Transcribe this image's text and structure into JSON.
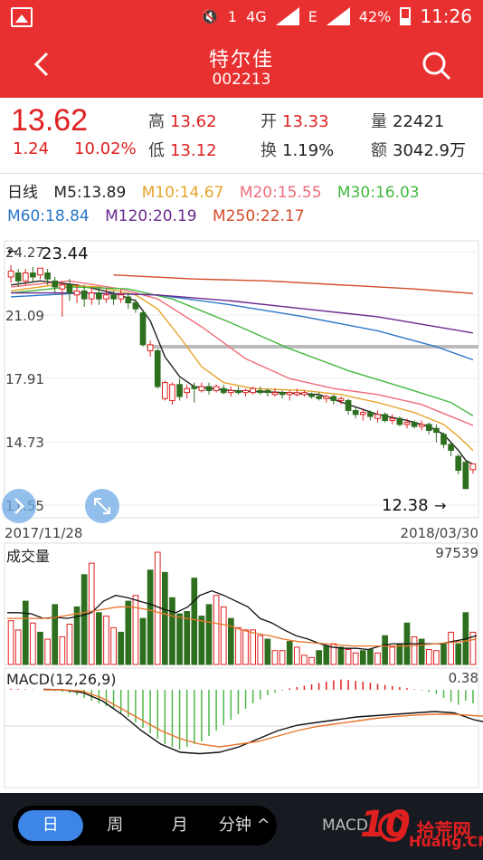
{
  "status_bar": {
    "signal_type_1": "4G",
    "signal_type_2": "E",
    "sim_badge": "1",
    "battery_percent": "42%",
    "time": "11:26"
  },
  "header": {
    "stock_name": "特尔佳",
    "stock_code": "002213",
    "back_icon": "chevron-left-icon",
    "search_icon": "search-icon"
  },
  "quote": {
    "price": "13.62",
    "change": "1.24",
    "change_pct": "10.02%",
    "high_label": "高",
    "high": "13.62",
    "open_label": "开",
    "open": "13.33",
    "volume_label": "量",
    "volume": "22421",
    "low_label": "低",
    "low": "13.12",
    "turnover_label": "换",
    "turnover": "1.19%",
    "amount_label": "额",
    "amount": "3042.9万"
  },
  "ma_legend": {
    "period": "日线",
    "items": [
      {
        "label": "M5:13.89",
        "color": "#222222"
      },
      {
        "label": "M10:14.67",
        "color": "#e6a32a"
      },
      {
        "label": "M20:15.55",
        "color": "#ef6d7a"
      },
      {
        "label": "M30:16.03",
        "color": "#43b83f"
      },
      {
        "label": "M60:18.84",
        "color": "#2a77c7"
      },
      {
        "label": "M120:20.19",
        "color": "#6a2a8f"
      },
      {
        "label": "M250:22.17",
        "color": "#d44a2a"
      }
    ]
  },
  "price_chart": {
    "y_labels": [
      "24.27",
      "21.09",
      "17.91",
      "14.73",
      "11.55"
    ],
    "max_marker": "23.44",
    "min_marker": "12.38",
    "start_date": "2017/11/28",
    "end_date": "2018/03/30"
  },
  "volume_chart": {
    "title": "成交量",
    "max_value": "97539"
  },
  "macd_chart": {
    "title": "MACD(12,26,9)",
    "value": "0.38"
  },
  "bottom_bar": {
    "periods": [
      {
        "label": "日",
        "active": true
      },
      {
        "label": "周",
        "active": false
      },
      {
        "label": "月",
        "active": false
      },
      {
        "label": "分钟 ^",
        "active": false
      }
    ],
    "indicator": "MACD",
    "watermark_digits": "10",
    "watermark_text": "拾荒网",
    "watermark_url": "Huang.CN"
  },
  "colors": {
    "up": "#e02020",
    "down": "#2e6e1f",
    "brand": "#e93030"
  },
  "chart_data": [
    {
      "type": "candlestick",
      "title": "",
      "x_range": [
        "2017/11/28",
        "2018/03/30"
      ],
      "ylim": [
        11.55,
        24.27
      ],
      "candles": [
        {
          "o": 23.0,
          "c": 23.3,
          "h": 23.6,
          "l": 22.7
        },
        {
          "o": 23.2,
          "c": 22.8,
          "h": 23.4,
          "l": 22.5
        },
        {
          "o": 22.8,
          "c": 23.2,
          "h": 23.4,
          "l": 22.6
        },
        {
          "o": 23.2,
          "c": 23.0,
          "h": 23.5,
          "l": 22.7
        },
        {
          "o": 23.1,
          "c": 23.44,
          "h": 23.44,
          "l": 22.9
        },
        {
          "o": 23.2,
          "c": 22.9,
          "h": 23.4,
          "l": 22.6
        },
        {
          "o": 22.8,
          "c": 22.5,
          "h": 23.0,
          "l": 22.2
        },
        {
          "o": 22.4,
          "c": 22.6,
          "h": 22.8,
          "l": 21.0
        },
        {
          "o": 22.6,
          "c": 22.2,
          "h": 22.9,
          "l": 21.8
        },
        {
          "o": 22.1,
          "c": 22.3,
          "h": 22.6,
          "l": 21.7
        },
        {
          "o": 22.3,
          "c": 21.9,
          "h": 22.6,
          "l": 21.5
        },
        {
          "o": 21.9,
          "c": 22.2,
          "h": 22.5,
          "l": 21.6
        },
        {
          "o": 22.2,
          "c": 21.9,
          "h": 22.5,
          "l": 21.6
        },
        {
          "o": 21.9,
          "c": 22.1,
          "h": 22.4,
          "l": 21.7
        },
        {
          "o": 22.1,
          "c": 21.9,
          "h": 22.3,
          "l": 21.6
        },
        {
          "o": 21.9,
          "c": 22.1,
          "h": 22.4,
          "l": 21.7
        },
        {
          "o": 22.0,
          "c": 21.7,
          "h": 22.2,
          "l": 21.4
        },
        {
          "o": 21.7,
          "c": 21.4,
          "h": 21.9,
          "l": 21.2
        },
        {
          "o": 21.2,
          "c": 19.6,
          "h": 21.3,
          "l": 19.5
        },
        {
          "o": 19.3,
          "c": 19.6,
          "h": 19.8,
          "l": 19.0
        },
        {
          "o": 19.3,
          "c": 17.5,
          "h": 19.4,
          "l": 17.4
        },
        {
          "o": 16.9,
          "c": 17.7,
          "h": 17.8,
          "l": 16.8
        },
        {
          "o": 16.8,
          "c": 17.6,
          "h": 17.7,
          "l": 16.6
        },
        {
          "o": 17.6,
          "c": 17.0,
          "h": 17.9,
          "l": 16.8
        },
        {
          "o": 17.2,
          "c": 17.4,
          "h": 17.6,
          "l": 16.9
        },
        {
          "o": 17.5,
          "c": 17.4,
          "h": 17.7,
          "l": 16.7
        },
        {
          "o": 17.3,
          "c": 17.5,
          "h": 17.7,
          "l": 17.2
        },
        {
          "o": 17.5,
          "c": 17.3,
          "h": 17.7,
          "l": 17.1
        },
        {
          "o": 17.3,
          "c": 17.5,
          "h": 17.6,
          "l": 17.2
        },
        {
          "o": 17.4,
          "c": 17.2,
          "h": 17.6,
          "l": 17.1
        },
        {
          "o": 17.2,
          "c": 17.3,
          "h": 17.5,
          "l": 17.0
        },
        {
          "o": 17.3,
          "c": 17.2,
          "h": 17.5,
          "l": 17.1
        },
        {
          "o": 17.2,
          "c": 17.3,
          "h": 17.4,
          "l": 17.0
        },
        {
          "o": 17.2,
          "c": 17.4,
          "h": 17.5,
          "l": 17.1
        },
        {
          "o": 17.3,
          "c": 17.2,
          "h": 17.5,
          "l": 17.1
        },
        {
          "o": 17.3,
          "c": 17.2,
          "h": 17.4,
          "l": 17.0
        },
        {
          "o": 17.1,
          "c": 17.2,
          "h": 17.4,
          "l": 17.0
        },
        {
          "o": 17.2,
          "c": 17.1,
          "h": 17.3,
          "l": 16.9
        },
        {
          "o": 17.1,
          "c": 17.2,
          "h": 17.3,
          "l": 16.8
        },
        {
          "o": 17.1,
          "c": 17.2,
          "h": 17.4,
          "l": 17.0
        },
        {
          "o": 17.1,
          "c": 17.2,
          "h": 17.3,
          "l": 17.0
        },
        {
          "o": 17.1,
          "c": 17.0,
          "h": 17.2,
          "l": 16.9
        },
        {
          "o": 17.0,
          "c": 16.9,
          "h": 17.2,
          "l": 16.8
        },
        {
          "o": 16.9,
          "c": 17.0,
          "h": 17.1,
          "l": 16.7
        },
        {
          "o": 17.0,
          "c": 16.8,
          "h": 17.1,
          "l": 16.6
        },
        {
          "o": 16.8,
          "c": 16.9,
          "h": 17.0,
          "l": 16.6
        },
        {
          "o": 16.8,
          "c": 16.3,
          "h": 16.9,
          "l": 16.1
        },
        {
          "o": 16.3,
          "c": 16.1,
          "h": 16.5,
          "l": 15.9
        },
        {
          "o": 16.1,
          "c": 16.2,
          "h": 16.4,
          "l": 15.8
        },
        {
          "o": 16.2,
          "c": 16.0,
          "h": 16.3,
          "l": 15.8
        },
        {
          "o": 15.9,
          "c": 16.1,
          "h": 16.3,
          "l": 15.7
        },
        {
          "o": 16.1,
          "c": 15.8,
          "h": 16.2,
          "l": 15.7
        },
        {
          "o": 15.8,
          "c": 15.9,
          "h": 16.1,
          "l": 15.6
        },
        {
          "o": 15.9,
          "c": 15.6,
          "h": 16.0,
          "l": 15.5
        },
        {
          "o": 15.6,
          "c": 15.7,
          "h": 15.9,
          "l": 15.4
        },
        {
          "o": 15.7,
          "c": 15.5,
          "h": 15.8,
          "l": 15.4
        },
        {
          "o": 15.5,
          "c": 15.6,
          "h": 15.8,
          "l": 15.3
        },
        {
          "o": 15.6,
          "c": 15.3,
          "h": 15.7,
          "l": 15.1
        },
        {
          "o": 15.4,
          "c": 15.2,
          "h": 15.6,
          "l": 14.7
        },
        {
          "o": 15.1,
          "c": 14.6,
          "h": 15.2,
          "l": 14.4
        },
        {
          "o": 14.6,
          "c": 14.3,
          "h": 14.7,
          "l": 14.0
        },
        {
          "o": 14.0,
          "c": 13.3,
          "h": 14.1,
          "l": 13.1
        },
        {
          "o": 13.7,
          "c": 12.38,
          "h": 13.8,
          "l": 12.38
        },
        {
          "o": 13.33,
          "c": 13.62,
          "h": 13.62,
          "l": 13.12
        }
      ],
      "ma_series": [
        {
          "name": "M5",
          "color": "#222222",
          "values": [
            [
              0,
              22.6
            ],
            [
              4,
              22.8
            ],
            [
              9,
              22.6
            ],
            [
              14,
              22.2
            ],
            [
              17,
              21.8
            ],
            [
              19,
              20.8
            ],
            [
              21,
              19.0
            ],
            [
              23,
              18.0
            ],
            [
              25,
              17.5
            ],
            [
              30,
              17.3
            ],
            [
              37,
              17.2
            ],
            [
              42,
              17.1
            ],
            [
              46,
              16.6
            ],
            [
              50,
              16.1
            ],
            [
              54,
              15.8
            ],
            [
              57,
              15.5
            ],
            [
              59,
              15.1
            ],
            [
              61,
              14.3
            ],
            [
              62,
              13.8
            ],
            [
              63,
              13.6
            ]
          ]
        },
        {
          "name": "M10",
          "color": "#e6a32a",
          "values": [
            [
              0,
              22.3
            ],
            [
              6,
              22.6
            ],
            [
              12,
              22.5
            ],
            [
              17,
              22.1
            ],
            [
              20,
              21.4
            ],
            [
              23,
              20.0
            ],
            [
              26,
              18.5
            ],
            [
              29,
              17.7
            ],
            [
              33,
              17.4
            ],
            [
              40,
              17.3
            ],
            [
              45,
              17.1
            ],
            [
              50,
              16.7
            ],
            [
              55,
              16.2
            ],
            [
              59,
              15.6
            ],
            [
              61,
              15.0
            ],
            [
              63,
              14.3
            ]
          ]
        },
        {
          "name": "M20",
          "color": "#ef6d7a",
          "values": [
            [
              0,
              22.5
            ],
            [
              8,
              22.8
            ],
            [
              15,
              22.4
            ],
            [
              20,
              21.9
            ],
            [
              26,
              20.5
            ],
            [
              32,
              18.9
            ],
            [
              38,
              17.9
            ],
            [
              44,
              17.4
            ],
            [
              50,
              17.1
            ],
            [
              56,
              16.6
            ],
            [
              60,
              16.0
            ],
            [
              63,
              15.55
            ]
          ]
        },
        {
          "name": "M30",
          "color": "#43b83f",
          "values": [
            [
              0,
              22.2
            ],
            [
              8,
              22.5
            ],
            [
              16,
              22.4
            ],
            [
              22,
              21.9
            ],
            [
              30,
              20.7
            ],
            [
              38,
              19.4
            ],
            [
              46,
              18.3
            ],
            [
              54,
              17.4
            ],
            [
              60,
              16.7
            ],
            [
              63,
              16.03
            ]
          ]
        },
        {
          "name": "M60",
          "color": "#2a77c7",
          "values": [
            [
              0,
              22.0
            ],
            [
              10,
              22.2
            ],
            [
              20,
              22.1
            ],
            [
              30,
              21.6
            ],
            [
              40,
              21.0
            ],
            [
              50,
              20.3
            ],
            [
              58,
              19.5
            ],
            [
              63,
              18.84
            ]
          ]
        },
        {
          "name": "M120",
          "color": "#6a2a8f",
          "values": [
            [
              0,
              22.2
            ],
            [
              10,
              22.2
            ],
            [
              20,
              22.1
            ],
            [
              30,
              21.8
            ],
            [
              40,
              21.4
            ],
            [
              50,
              21.0
            ],
            [
              58,
              20.5
            ],
            [
              63,
              20.19
            ]
          ]
        },
        {
          "name": "M250",
          "color": "#d44a2a",
          "values": [
            [
              14,
              23.1
            ],
            [
              25,
              22.9
            ],
            [
              35,
              22.8
            ],
            [
              45,
              22.6
            ],
            [
              55,
              22.4
            ],
            [
              63,
              22.17
            ]
          ]
        }
      ],
      "reference_line": 19.5
    },
    {
      "type": "bar",
      "title": "成交量",
      "ylim": [
        0,
        97539
      ],
      "values": [
        38000,
        30000,
        55000,
        36000,
        28000,
        22000,
        52000,
        24000,
        35000,
        50000,
        78000,
        88000,
        45000,
        42000,
        32000,
        28000,
        55000,
        60000,
        40000,
        82000,
        97539,
        80000,
        58000,
        44000,
        46000,
        75000,
        42000,
        52000,
        60000,
        50000,
        40000,
        32000,
        30000,
        30000,
        25000,
        22000,
        12000,
        12000,
        20000,
        15000,
        8000,
        6000,
        12000,
        16000,
        18000,
        15000,
        13000,
        10000,
        12000,
        13000,
        10000,
        25000,
        15000,
        18000,
        36000,
        24000,
        22000,
        13000,
        12000,
        18000,
        28000,
        18000,
        45000,
        28000
      ],
      "up": [
        1,
        1,
        0,
        1,
        0,
        1,
        0,
        1,
        1,
        0,
        0,
        1,
        0,
        1,
        1,
        0,
        0,
        1,
        0,
        0,
        1,
        0,
        0,
        0,
        0,
        0,
        0,
        0,
        1,
        1,
        0,
        1,
        1,
        1,
        1,
        0,
        1,
        1,
        0,
        1,
        1,
        1,
        0,
        0,
        1,
        0,
        1,
        1,
        0,
        0,
        1,
        0,
        1,
        0,
        0,
        1,
        0,
        1,
        1,
        0,
        1,
        0,
        0,
        1
      ],
      "ma1": [
        45000,
        45000,
        44000,
        40000,
        41000,
        40000,
        42000,
        45000,
        55000,
        60000,
        58000,
        55000,
        52000,
        48000,
        45000,
        50000,
        60000,
        64000,
        60000,
        55000,
        50000,
        40000,
        36000,
        30000,
        25000,
        22000,
        18000,
        15000,
        14000,
        14000,
        13000,
        16000,
        18000,
        18000,
        18000,
        18000,
        18000,
        20000,
        22000,
        25000
      ],
      "ma2": [
        40000,
        40000,
        40000,
        40000,
        42000,
        44000,
        46000,
        48000,
        50000,
        50000,
        48000,
        45000,
        42000,
        40000,
        38000,
        36000,
        34000,
        30000,
        27000,
        25000,
        22000,
        20000,
        19000,
        18000,
        17000,
        16000,
        16000,
        16000,
        16000,
        16000,
        17000,
        18000,
        19000,
        20000,
        22000
      ]
    },
    {
      "type": "bar",
      "title": "MACD(12,26,9)",
      "values": [
        0.04,
        0.03,
        0.02,
        0.01,
        0.0,
        -0.02,
        -0.05,
        -0.08,
        -0.12,
        -0.2,
        -0.3,
        -0.4,
        -0.5,
        -0.6,
        -0.7,
        -0.85,
        -1.0,
        -1.2,
        -1.4,
        -1.6,
        -1.8,
        -2.0,
        -2.1,
        -2.2,
        -2.1,
        -2.0,
        -1.9,
        -1.7,
        -1.5,
        -1.3,
        -1.1,
        -0.9,
        -0.7,
        -0.5,
        -0.35,
        -0.2,
        -0.1,
        -0.03,
        0.05,
        0.1,
        0.15,
        0.2,
        0.25,
        0.3,
        0.35,
        0.38,
        0.36,
        0.33,
        0.3,
        0.26,
        0.22,
        0.18,
        0.14,
        0.1,
        0.06,
        0.02,
        -0.02,
        -0.08,
        -0.15,
        -0.3,
        -0.45,
        -0.55,
        -0.4,
        -0.5
      ],
      "dif": [
        0.02,
        0.0,
        -0.1,
        -0.4,
        -0.9,
        -1.5,
        -2.0,
        -2.3,
        -2.35,
        -2.3,
        -2.1,
        -1.8,
        -1.5,
        -1.3,
        -1.2,
        -1.1,
        -1.0,
        -0.95,
        -0.9,
        -0.85,
        -0.8,
        -0.85,
        -1.1,
        -1.25,
        -1.3
      ],
      "dea": [
        0.0,
        0.0,
        -0.05,
        -0.3,
        -0.7,
        -1.1,
        -1.5,
        -1.8,
        -2.0,
        -2.1,
        -2.0,
        -1.9,
        -1.7,
        -1.5,
        -1.35,
        -1.25,
        -1.15,
        -1.05,
        -0.98,
        -0.93,
        -0.9,
        -0.9,
        -0.95,
        -1.0,
        -1.05
      ],
      "ylim": [
        -2.5,
        0.4
      ]
    }
  ]
}
